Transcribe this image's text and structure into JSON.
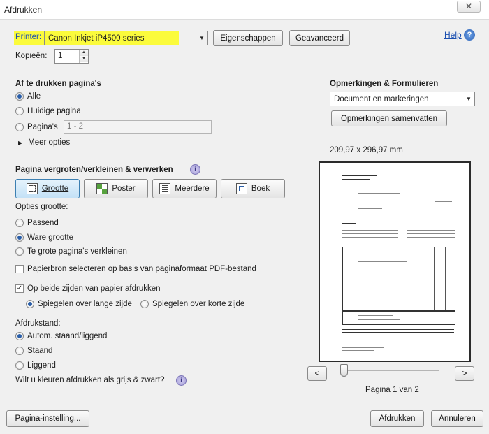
{
  "window": {
    "title": "Afdrukken",
    "close": "✕"
  },
  "printer": {
    "label": "Printer:",
    "value": "Canon Inkjet iP4500 series",
    "properties_button": "Eigenschappen",
    "advanced_button": "Geavanceerd"
  },
  "help": {
    "label": "Help",
    "icon": "help-icon"
  },
  "copies": {
    "label": "Kopieën:",
    "value": "1"
  },
  "pages": {
    "title": "Af te drukken pagina's",
    "all": "Alle",
    "current": "Huidige pagina",
    "pages_label": "Pagina's",
    "range_value": "1 - 2",
    "more_options": "Meer opties"
  },
  "comments": {
    "title": "Opmerkingen & Formulieren",
    "selected": "Document en markeringen",
    "summarize_button": "Opmerkingen samenvatten"
  },
  "page_size": "209,97 x 296,97 mm",
  "scaling": {
    "title": "Pagina vergroten/verkleinen & verwerken",
    "buttons": {
      "size": "Grootte",
      "poster": "Poster",
      "multiple": "Meerdere",
      "book": "Boek"
    },
    "options_title": "Opties grootte:",
    "fit": "Passend",
    "actual": "Ware grootte",
    "shrink": "Te grote pagina's verkleinen",
    "paper_source": "Papierbron selecteren op basis van paginaformaat PDF-bestand",
    "duplex": "Op beide zijden van papier afdrukken",
    "flip_long": "Spiegelen over lange zijde",
    "flip_short": "Spiegelen over korte zijde"
  },
  "orientation": {
    "title": "Afdrukstand:",
    "auto": "Autom. staand/liggend",
    "portrait": "Staand",
    "landscape": "Liggend"
  },
  "grayscale_question": "Wilt u kleuren afdrukken als grijs & zwart?",
  "preview": {
    "prev": "<",
    "next": ">",
    "page_label": "Pagina 1 van 2"
  },
  "footer": {
    "page_setup": "Pagina-instelling...",
    "print": "Afdrukken",
    "cancel": "Annuleren"
  },
  "colors": {
    "printer_highlight": "#fbfb3c",
    "accent": "#2a5ea8"
  }
}
